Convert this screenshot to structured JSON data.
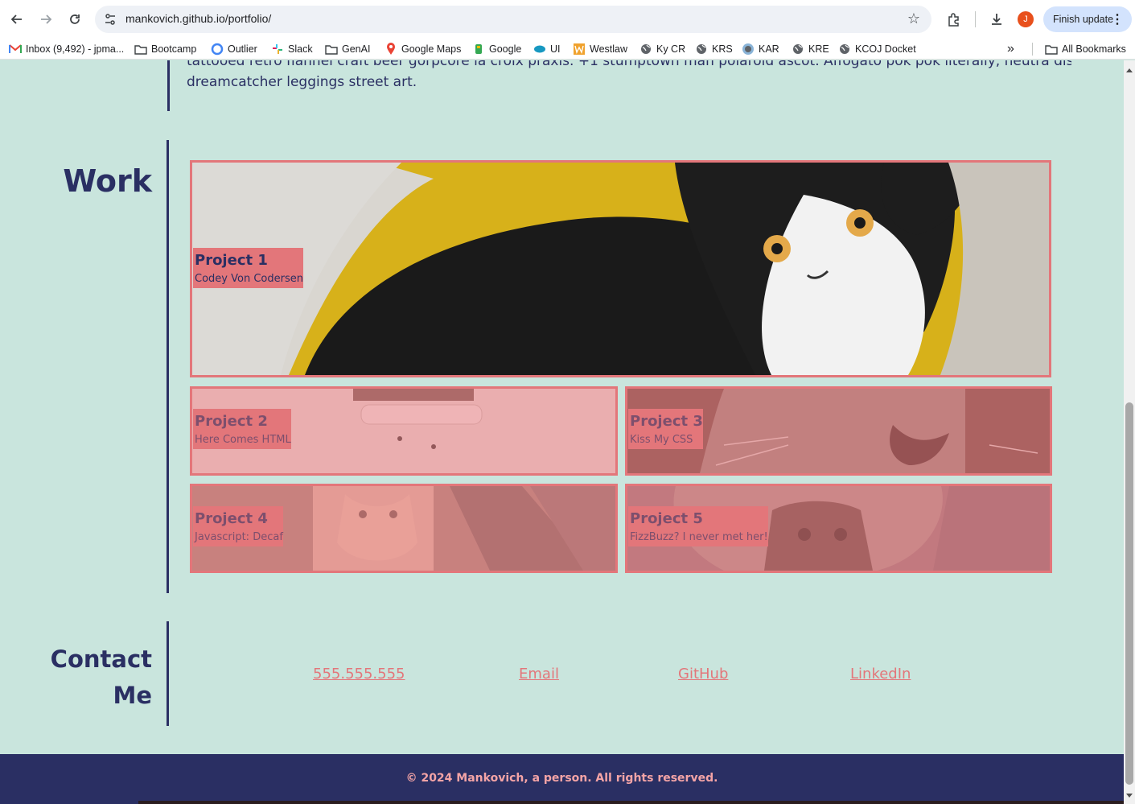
{
  "browser": {
    "url": "mankovich.github.io/portfolio/",
    "profile_initial": "J",
    "finish_update_label": "Finish update",
    "bookmarks": [
      {
        "label": "Inbox (9,492) - jpma...",
        "icon": "gmail-icon"
      },
      {
        "label": "Bootcamp",
        "icon": "folder-icon"
      },
      {
        "label": "Outlier",
        "icon": "outlier-icon"
      },
      {
        "label": "Slack",
        "icon": "slack-icon"
      },
      {
        "label": "GenAI",
        "icon": "folder-icon"
      },
      {
        "label": "Google Maps",
        "icon": "maps-icon"
      },
      {
        "label": "Google",
        "icon": "google-icon"
      },
      {
        "label": "UI",
        "icon": "salesforce-icon"
      },
      {
        "label": "Westlaw",
        "icon": "westlaw-icon"
      },
      {
        "label": "Ky CR",
        "icon": "globe-icon"
      },
      {
        "label": "KRS",
        "icon": "globe-icon"
      },
      {
        "label": "KAR",
        "icon": "globe-icon"
      },
      {
        "label": "KRE",
        "icon": "globe-icon"
      },
      {
        "label": "KCOJ Docket",
        "icon": "globe-icon"
      }
    ],
    "all_bookmarks_label": "All Bookmarks"
  },
  "about": {
    "tail_line1": "tattooed retro flannel craft beer gorpcore la croix praxis. +1 stumptown man polaroid ascot. Affogato pok pok literally, neutra distillery",
    "tail_line2": "dreamcatcher leggings street art."
  },
  "work": {
    "title": "Work",
    "projects": [
      {
        "title": "Project 1",
        "subtitle": "Codey Von Codersen"
      },
      {
        "title": "Project 2",
        "subtitle": "Here Comes HTML"
      },
      {
        "title": "Project 3",
        "subtitle": "Kiss My CSS"
      },
      {
        "title": "Project 4",
        "subtitle": "Javascript: Decaf"
      },
      {
        "title": "Project 5",
        "subtitle": "FizzBuzz? I never met her!"
      }
    ]
  },
  "contact": {
    "title_line1": "Contact",
    "title_line2": "Me",
    "links": [
      "555.555.555",
      "Email",
      "GitHub",
      "LinkedIn"
    ]
  },
  "footer": {
    "text": "© 2024 Mankovich, a person. All rights reserved."
  },
  "colors": {
    "background": "#c9e5dd",
    "navy": "#2a2f63",
    "coral": "#e3767a",
    "footer_text": "#f4a4a6"
  }
}
